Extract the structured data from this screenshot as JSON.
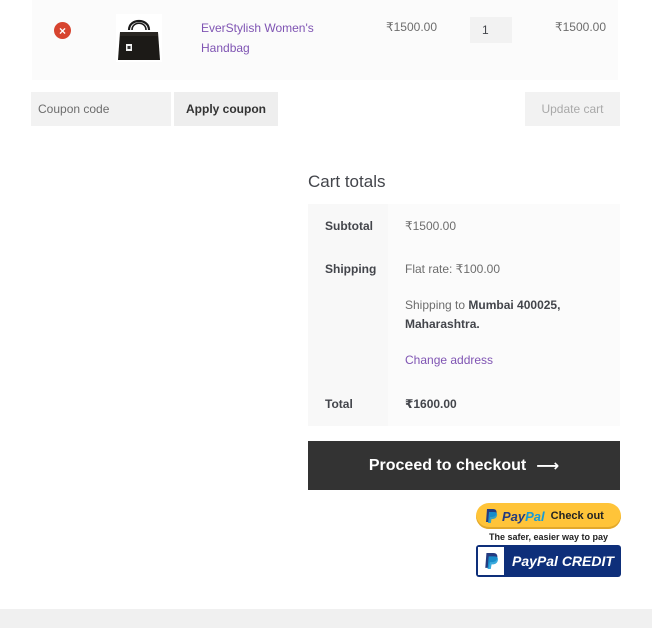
{
  "cart": {
    "remove_label": "×",
    "product_name": "EverStylish Women's Handbag",
    "price": "₹1500.00",
    "quantity": "1",
    "subtotal": "₹1500.00"
  },
  "coupon": {
    "placeholder": "Coupon code",
    "apply_label": "Apply coupon",
    "update_label": "Update cart"
  },
  "totals": {
    "title": "Cart totals",
    "subtotal_label": "Subtotal",
    "subtotal_value": "₹1500.00",
    "shipping_label": "Shipping",
    "shipping_method": "Flat rate: ₹100.00",
    "shipping_to_prefix": "Shipping to",
    "shipping_to_place": "Mumbai 400025,",
    "shipping_to_state": "Maharashtra.",
    "change_address": "Change address",
    "total_label": "Total",
    "total_value": "₹1600.00"
  },
  "checkout": {
    "label": "Proceed to checkout",
    "arrow": "⟶"
  },
  "paypal": {
    "pay": "Pay",
    "pal": "Pal",
    "checkout_label": "Check out",
    "tagline": "The safer, easier way to pay",
    "credit_label": "PayPal CREDIT"
  },
  "colors": {
    "link": "#7f54b3",
    "remove": "#d7442f",
    "checkout_bg": "#333333",
    "paypal_yellow": "#ffc439",
    "paypal_navy": "#0e2f7a"
  }
}
